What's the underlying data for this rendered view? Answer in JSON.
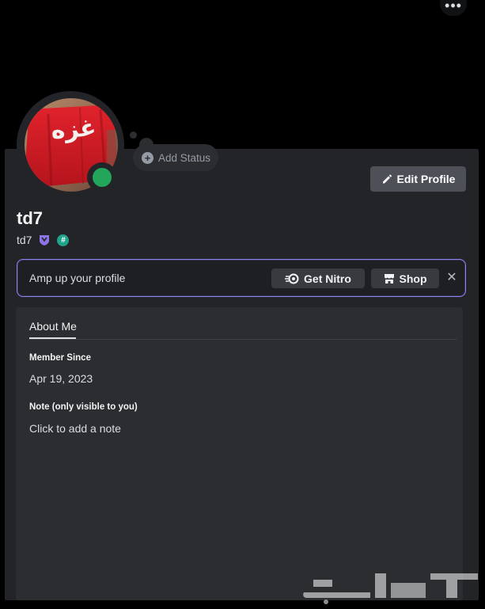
{
  "header": {
    "more_icon": "more-horizontal-icon",
    "more_label": "•••"
  },
  "profile": {
    "display_name": "td7",
    "username": "td7",
    "avatar_text": "غزه",
    "status_color": "#23a55a",
    "badges": [
      "shield-badge-icon",
      "hash-badge-icon"
    ],
    "hash_badge_label": "#"
  },
  "add_status": {
    "label": "Add Status",
    "icon": "plus-circle-icon",
    "plus": "+"
  },
  "edit_profile": {
    "label": "Edit Profile",
    "icon": "pencil-icon"
  },
  "promo": {
    "text": "Amp up your profile",
    "nitro_label": "Get Nitro",
    "nitro_icon": "nitro-icon",
    "shop_label": "Shop",
    "shop_icon": "shop-icon",
    "close_icon": "close-icon",
    "close_label": "✕",
    "accent": "#8c84f0"
  },
  "tabs": [
    {
      "label": "About Me",
      "active": true
    }
  ],
  "about": {
    "member_since_label": "Member Since",
    "member_since_value": "Apr 19, 2023",
    "note_label": "Note (only visible to you)",
    "note_placeholder": "Click to add a note"
  },
  "watermark": {
    "text": "حراج"
  }
}
